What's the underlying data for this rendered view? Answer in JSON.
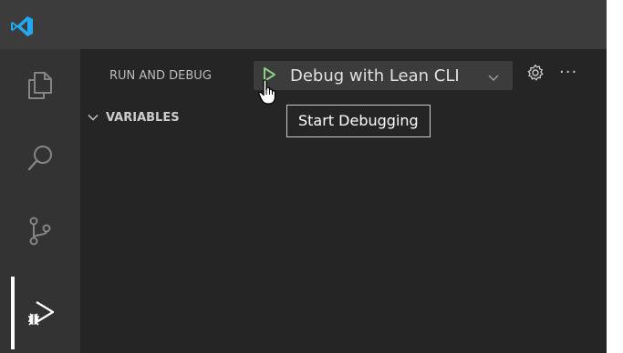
{
  "titlebar": {
    "logo_icon": "vscode-logo-icon"
  },
  "activity_bar": {
    "items": [
      {
        "icon": "files-icon",
        "label": "Explorer",
        "active": false
      },
      {
        "icon": "search-icon",
        "label": "Search",
        "active": false
      },
      {
        "icon": "source-control-icon",
        "label": "Source Control",
        "active": false
      },
      {
        "icon": "run-debug-icon",
        "label": "Run and Debug",
        "active": true
      }
    ]
  },
  "debug_view": {
    "title": "RUN AND DEBUG",
    "start_icon": "play-icon",
    "configuration": "Debug with Lean CLI",
    "chevron_icon": "chevron-down-icon",
    "gear_icon": "gear-icon",
    "more_label": "···",
    "sections": [
      {
        "title": "VARIABLES",
        "expanded": true
      }
    ]
  },
  "tooltip": {
    "text": "Start Debugging"
  },
  "colors": {
    "titlebar": "#3c3c3c",
    "activity_bar": "#333333",
    "sidebar": "#252526",
    "play": "#89d185",
    "accent_logo": "#23a9f2"
  }
}
